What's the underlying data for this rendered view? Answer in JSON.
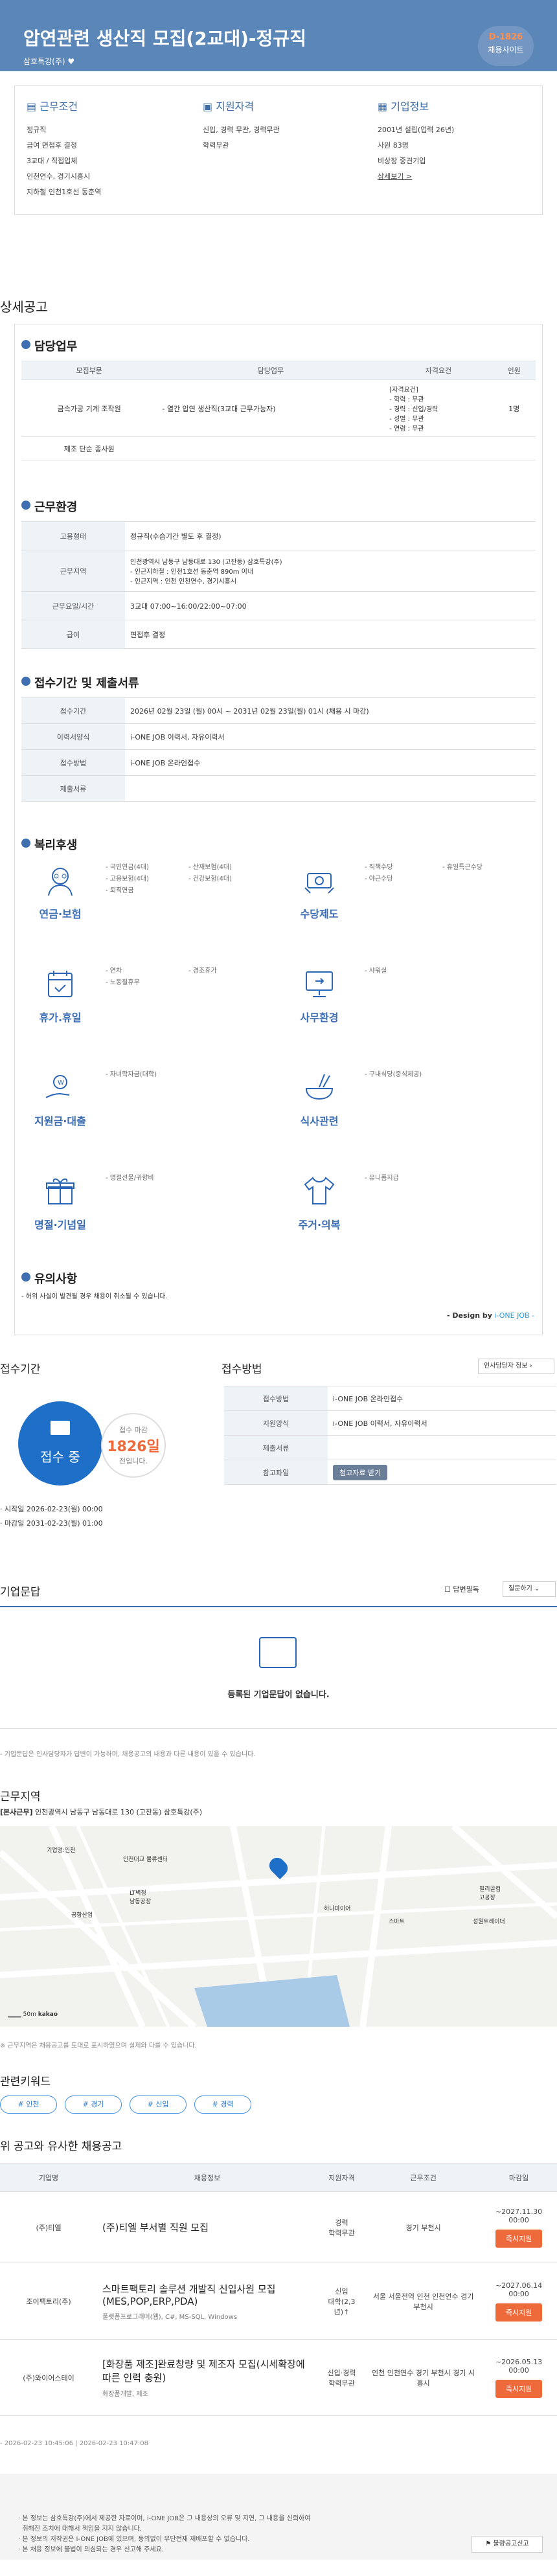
{
  "header": {
    "title": "압연관련 생산직 모집(2교대)-정규직",
    "company": "삼호특강(주)",
    "dday": "D-1826",
    "dday_label": "채용사이트"
  },
  "summary": {
    "cond": {
      "title": "근무조건",
      "items": [
        "정규직",
        "급여 면접후 결정",
        "3교대 / 직접업체",
        "인천연수, 경기시흥시",
        "지하철 인천1호선 동춘역"
      ]
    },
    "qual": {
      "title": "지원자격",
      "items": [
        "신입, 경력 무관, 경력무관",
        "학력무관"
      ]
    },
    "comp": {
      "title": "기업정보",
      "items": [
        "2001년 설립(업력 26년)",
        "사원 83명",
        "비상장 중견기업"
      ],
      "link": "상세보기 >"
    }
  },
  "section_title": "상세공고",
  "duty": {
    "title": "담당업무",
    "headers": [
      "모집부문",
      "담당업무",
      "자격요건",
      "인원"
    ],
    "rows": [
      [
        "금속가공 기계 조작원",
        "- 열간 압연 생산직(3교대 근무가능자)",
        "[자격요건]\n- 학력 : 무관\n- 경력 : 신입/경력\n- 성별 : 무관\n- 연령 : 무관",
        "1명"
      ],
      [
        "제조 단순 종사원",
        "",
        "",
        ""
      ]
    ]
  },
  "env": {
    "title": "근무환경",
    "rows": [
      [
        "고용형태",
        "정규직(수습기간 별도 후 결정)"
      ],
      [
        "근무지역",
        "인천광역시 남동구 남동대로 130 (고잔동) 삼호특강(주)\n- 인근지하철 : 인천1호선 동춘역 890m 이내\n- 인근지역 : 인천 인천연수, 경기시흥시"
      ],
      [
        "근무요일/시간",
        "3교대 07:00~16:00/22:00~07:00"
      ],
      [
        "급여",
        "면접후 결정"
      ]
    ]
  },
  "apply_info": {
    "title": "접수기간 및 제출서류",
    "rows": [
      [
        "접수기간",
        "2026년 02월 23일 (월) 00시 ~ 2031년 02월 23일(월) 01시 (채용 시 마감)"
      ],
      [
        "이력서양식",
        "i-ONE JOB 이력서, 자유이력서"
      ],
      [
        "접수방법",
        "i-ONE JOB 온라인접수"
      ],
      [
        "제출서류",
        ""
      ]
    ]
  },
  "welfare": {
    "title": "복리후생",
    "items": [
      {
        "label": "연금·보험",
        "icon": "pension-icon",
        "text": [
          "- 국민연금(4대)",
          "- 고용보험(4대)",
          "- 퇴직연금",
          "- 산재보험(4대)",
          "- 건강보험(4대)"
        ]
      },
      {
        "label": "수당제도",
        "icon": "allowance-icon",
        "text": [
          "- 직책수당",
          "- 야근수당",
          "- 휴일특근수당"
        ]
      },
      {
        "label": "휴가.휴일",
        "icon": "calendar-icon",
        "text": [
          "- 연차",
          "- 노동절휴무",
          "- 경조휴가"
        ]
      },
      {
        "label": "사무환경",
        "icon": "monitor-icon",
        "text": [
          "- 샤워실"
        ]
      },
      {
        "label": "지원금·대출",
        "icon": "money-icon",
        "text": [
          "- 자녀학자금(대학)"
        ]
      },
      {
        "label": "식사관련",
        "icon": "meal-icon",
        "text": [
          "- 구내식당(중식제공)"
        ]
      },
      {
        "label": "명절·기념일",
        "icon": "gift-icon",
        "text": [
          "- 명절선물/귀향비"
        ]
      },
      {
        "label": "주거·의복",
        "icon": "clothes-icon",
        "text": [
          "- 유니폼지급"
        ]
      }
    ]
  },
  "caution": {
    "title": "유의사항",
    "text": "- 허위 사실이 발견될 경우 채용이 취소될 수 있습니다.",
    "design": "- Design by",
    "design2": "i-ONE JOB -"
  },
  "period": {
    "title": "접수기간",
    "status": "접수 중",
    "remain_label": "접수 마감",
    "remain": "1826일",
    "remain_tail": "전입니다.",
    "start": "· 시작일 2026-02-23(월) 00:00",
    "end": "· 마감일 2031-02-23(월) 01:00"
  },
  "method": {
    "title": "접수방법",
    "tab": "인사담당자 정보",
    "rows": [
      [
        "접수방법",
        "i-ONE JOB 온라인접수"
      ],
      [
        "지원양식",
        "i-ONE JOB 이력서, 자유이력서"
      ],
      [
        "제출서류",
        ""
      ],
      [
        "참고파일",
        "첨고자료 받기"
      ]
    ]
  },
  "qna": {
    "title": "기업문답",
    "check": "답변필독",
    "sort": "질문하기",
    "empty": "등록된 기업문답이 없습니다.",
    "note": "- 기업문답은 인사담당자가 답변이 가능하며, 채용공고의 내용과 다른 내용이 있을 수 있습니다."
  },
  "location": {
    "title": "근무지역",
    "addr_label": "[본사근무]",
    "addr": "인천광역시 남동구 남동대로 130 (고잔동) 삼호특강(주)",
    "note": "※ 근무지역은 채용공고를 토대로 표시하였으며 실제와 다를 수 있습니다.",
    "scale": "50m",
    "brand": "kakao",
    "places": [
      "기업명:인천",
      "H환경",
      "기업진흥",
      "LT벽정\n남동공장",
      "공항산업",
      "인천대교\n물류센터",
      "하나파이어",
      "스마트",
      "필리골컴\n고공장",
      "성원트레이더",
      "한화글로벌"
    ]
  },
  "keywords": {
    "title": "관련키워드",
    "items": [
      "# 인천",
      "# 경기",
      "# 신입",
      "# 경력"
    ]
  },
  "similar": {
    "title": "위 공고와 유사한 채용공고",
    "headers": [
      "기업명",
      "채용정보",
      "지원자격",
      "근무조건",
      "마감일"
    ],
    "rows": [
      {
        "company": "(주)티엘",
        "title": "(주)티엘 부서별 직원 모집",
        "sub": "",
        "qual": "경력\n학력무관",
        "cond": "경기 부천시",
        "deadline": "~2027.11.30 00:00",
        "btn": "즉시지원"
      },
      {
        "company": "조이팩토리(주)",
        "title": "스마트팩토리 솔루션 개발직 신입사원 모집(MES,POP,ERP,PDA)",
        "sub": "풀랫폼프로그래머(웹), C#, MS-SQL, Windows",
        "qual": "신입\n대학(2,3년)↑",
        "cond": "서울 서울전역 인천 인천연수 경기 부천시",
        "deadline": "~2027.06.14 00:00",
        "btn": "즉시지원"
      },
      {
        "company": "(주)와이어스테이",
        "title": "[화장품 제조]완료창량 및 제조자 모집(시세확장에 따른 인력 충원)",
        "sub": "화장품개발, 제조",
        "qual": "신입·경력\n학력무관",
        "cond": "인천 인천연수 경기 부천시 경기 시흥시",
        "deadline": "~2026.05.13 00:00",
        "btn": "즉시지원"
      }
    ]
  },
  "dates": "- 2026-02-23 10:45:06 | 2026-02-23 10:47:08",
  "footer": {
    "lines": [
      "· 본 정보는 삼호특강(주)에서 제공한 자료이며, i-ONE JOB은 그 내용상의 오류 및 지연, 그 내용을 신뢰하여",
      "  취해진 조치에 대해서 책임을 지지 않습니다.",
      "· 본 정보의 저작권은 I-ONE JOB에 있으며, 동의없이 무단전재 재배포할 수 없습니다.",
      "· 본 채용 정보에 불법이 의심되는 경우 신고해 주세요."
    ],
    "report": "불량공고신고"
  }
}
